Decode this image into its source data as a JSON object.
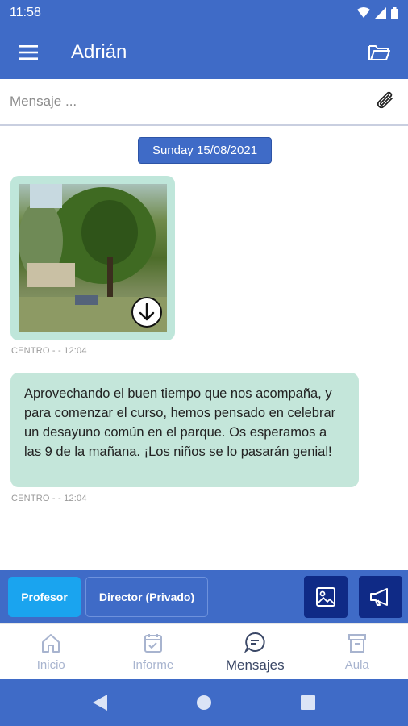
{
  "status": {
    "time": "11:58"
  },
  "header": {
    "title": "Adrián"
  },
  "composer": {
    "placeholder": "Mensaje ..."
  },
  "chat": {
    "date": "Sunday 15/08/2021",
    "messages": [
      {
        "type": "image",
        "meta": "CENTRO -  - 12:04"
      },
      {
        "type": "text",
        "text": "Aprovechando el buen tiempo que nos acompaña, y para comenzar el curso, hemos pensado en celebrar un desayuno común en el parque. Os esperamos a las 9 de la mañana. ¡Los niños se lo pasarán genial!",
        "meta": "CENTRO -  - 12:04"
      }
    ]
  },
  "actions": {
    "profesor": "Profesor",
    "director": "Director (Privado)"
  },
  "nav": {
    "inicio": "Inicio",
    "informe": "Informe",
    "mensajes": "Mensajes",
    "aula": "Aula"
  },
  "colors": {
    "primary": "#3f6bc7",
    "accent": "#1aa4ef",
    "bubble": "#c4e6da",
    "dark": "#0f2a86"
  }
}
